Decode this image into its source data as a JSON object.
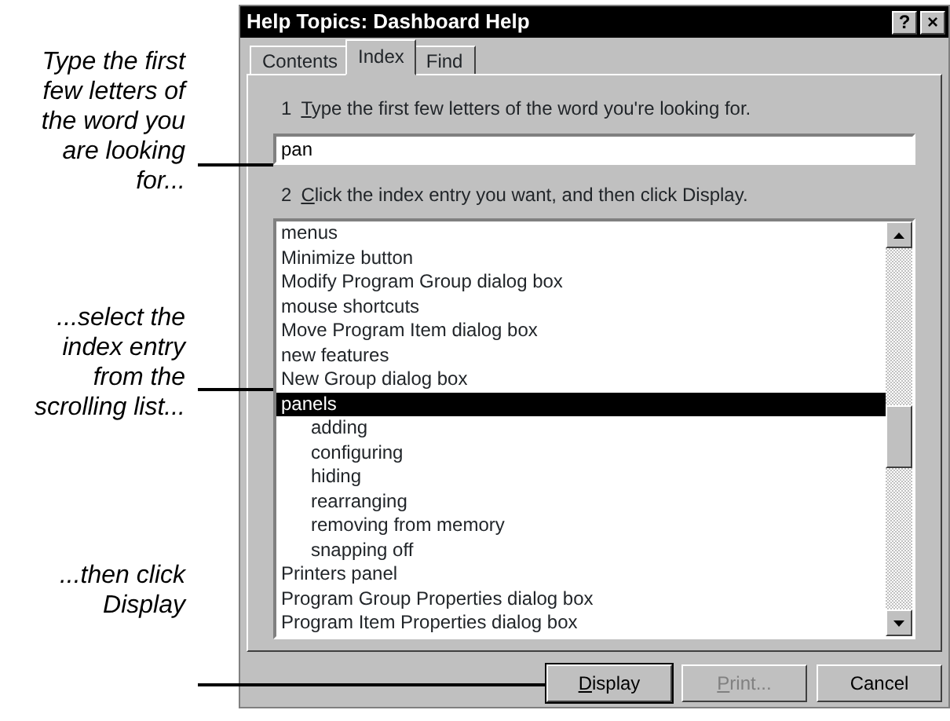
{
  "callouts": [
    {
      "text": "Type the first few letters of the word you are looking for..."
    },
    {
      "text": "...select the index entry from the scrolling list..."
    },
    {
      "text": "...then click Display"
    }
  ],
  "window": {
    "title": "Help Topics: Dashboard Help",
    "title_buttons": [
      "?",
      "×"
    ]
  },
  "tabs": [
    {
      "label": "Contents",
      "selected": false
    },
    {
      "label": "Index",
      "selected": true
    },
    {
      "label": "Find",
      "selected": false
    }
  ],
  "step1": {
    "number": "1",
    "text": "Type the first few letters of the word you're looking for.",
    "mnemonic": true
  },
  "search": {
    "value": "pan"
  },
  "step2": {
    "number": "2",
    "text": "Click the index entry you want, and then click Display.",
    "mnemonic": true
  },
  "index_list": [
    {
      "label": "menus",
      "selected": false
    },
    {
      "label": "Minimize button",
      "selected": false
    },
    {
      "label": "Modify Program Group dialog box",
      "selected": false
    },
    {
      "label": "mouse shortcuts",
      "selected": false
    },
    {
      "label": "Move Program Item dialog box",
      "selected": false
    },
    {
      "label": "new features",
      "selected": false
    },
    {
      "label": "New Group dialog box",
      "selected": false
    },
    {
      "label": "panels",
      "selected": true,
      "children": [
        {
          "label": "adding",
          "selected": false
        },
        {
          "label": "configuring",
          "selected": false
        },
        {
          "label": "hiding",
          "selected": false
        },
        {
          "label": "rearranging",
          "selected": false
        },
        {
          "label": "removing from memory",
          "selected": false
        },
        {
          "label": "snapping off",
          "selected": false
        }
      ]
    },
    {
      "label": "Printers panel",
      "selected": false
    },
    {
      "label": "Program Group Properties dialog box",
      "selected": false
    },
    {
      "label": "Program Item Properties dialog box",
      "selected": false
    }
  ],
  "buttons": [
    {
      "label": "Display",
      "mnemonic": true,
      "disabled": false,
      "default": true
    },
    {
      "label": "Print...",
      "mnemonic": true,
      "disabled": true,
      "default": false
    },
    {
      "label": "Cancel",
      "mnemonic": false,
      "disabled": false,
      "default": false
    }
  ]
}
